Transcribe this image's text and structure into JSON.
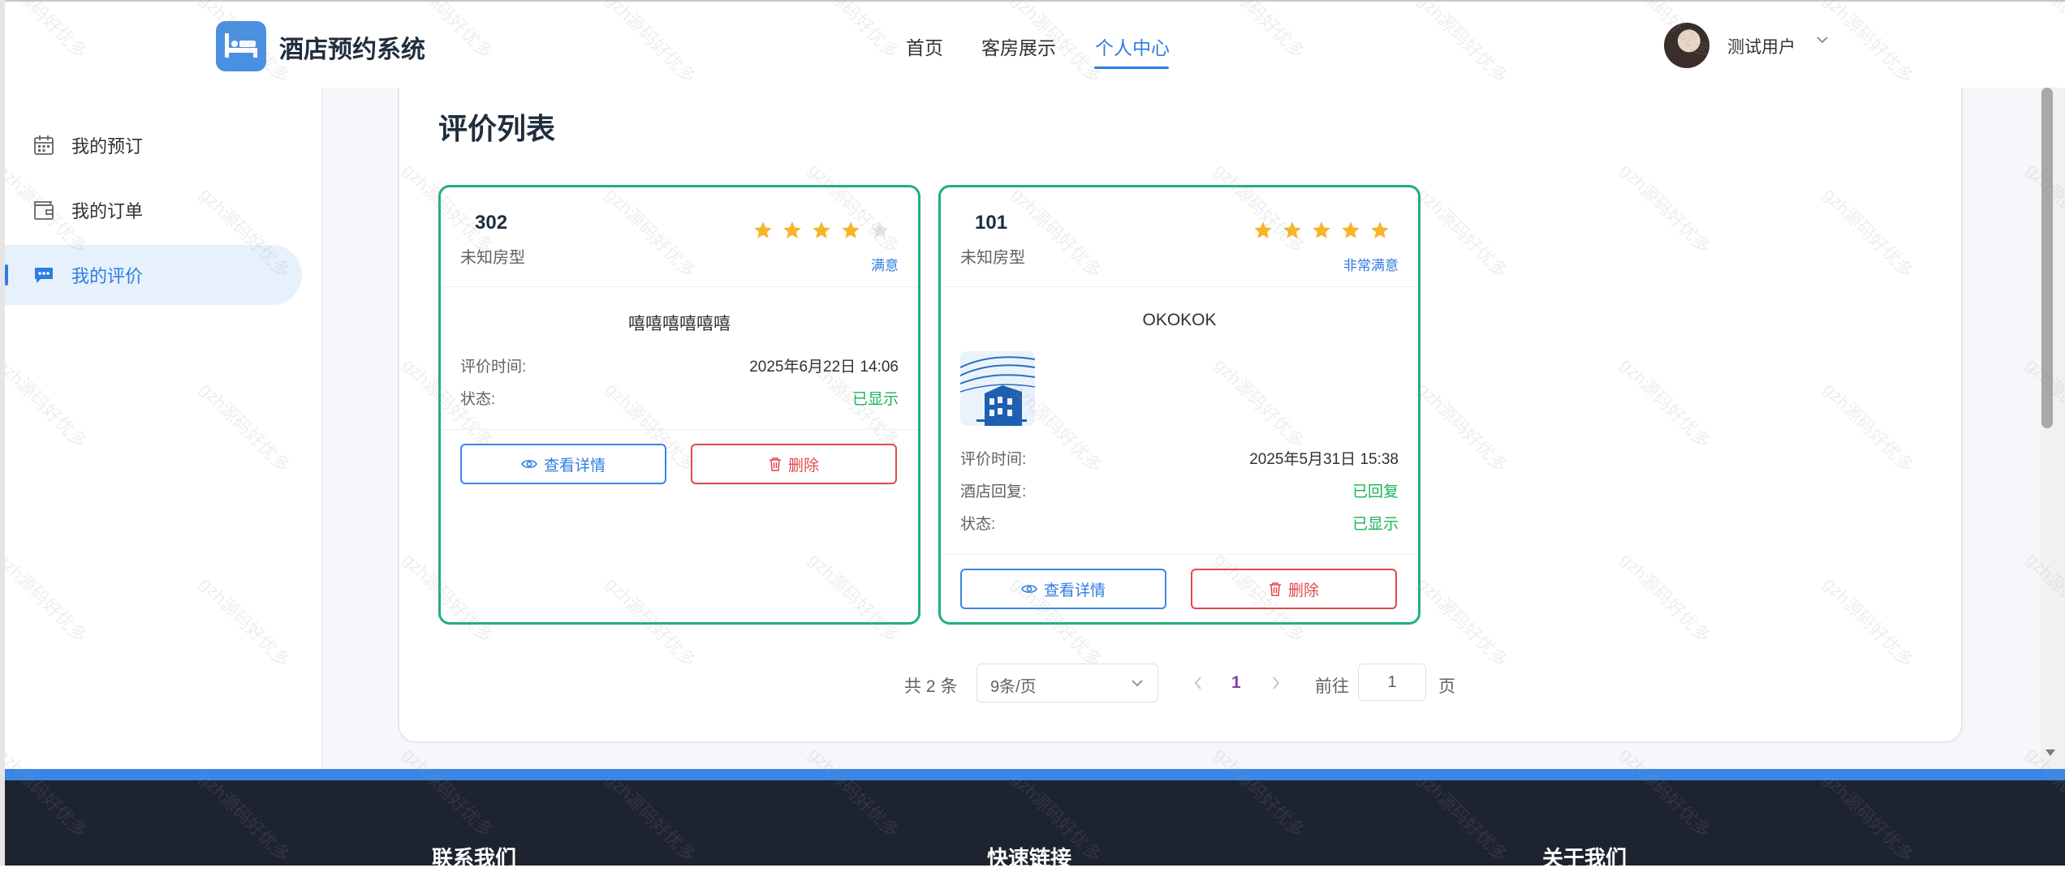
{
  "header": {
    "brand": "酒店预约系统",
    "nav": [
      {
        "label": "首页",
        "active": false
      },
      {
        "label": "客房展示",
        "active": false
      },
      {
        "label": "个人中心",
        "active": true
      }
    ],
    "user": {
      "name": "测试用户"
    }
  },
  "sidebar": {
    "items": [
      {
        "label": "我的预订",
        "icon": "calendar-icon",
        "active": false
      },
      {
        "label": "我的订单",
        "icon": "wallet-icon",
        "active": false
      },
      {
        "label": "我的评价",
        "icon": "chat-icon",
        "active": true
      }
    ]
  },
  "main": {
    "title": "评价列表",
    "cards": [
      {
        "room": "302",
        "room_type": "未知房型",
        "rating": 4,
        "max_rating": 5,
        "satisfaction": "满意",
        "comment": "嘻嘻嘻嘻嘻嘻",
        "rows": [
          {
            "label": "评价时间:",
            "value": "2025年6月22日 14:06",
            "color": "#303133"
          },
          {
            "label": "状态:",
            "value": "已显示",
            "color": "#19b35a"
          }
        ],
        "has_image": false,
        "detail_label": "查看详情",
        "delete_label": "删除"
      },
      {
        "room": "101",
        "room_type": "未知房型",
        "rating": 5,
        "max_rating": 5,
        "satisfaction": "非常满意",
        "comment": "OKOKOK",
        "rows": [
          {
            "label": "评价时间:",
            "value": "2025年5月31日 15:38",
            "color": "#303133"
          },
          {
            "label": "酒店回复:",
            "value": "已回复",
            "color": "#19b35a"
          },
          {
            "label": "状态:",
            "value": "已显示",
            "color": "#19b35a"
          }
        ],
        "has_image": true,
        "detail_label": "查看详情",
        "delete_label": "删除"
      }
    ]
  },
  "pagination": {
    "total_text": "共 2 条",
    "page_size": "9条/页",
    "current_page": "1",
    "goto_label": "前往",
    "goto_value": "1",
    "page_suffix": "页"
  },
  "footer": {
    "headings": [
      "联系我们",
      "快速链接",
      "关于我们"
    ]
  },
  "watermark": "gzh源码好优多",
  "colors": {
    "accent": "#2f7de1",
    "card_border": "#21b07d",
    "danger": "#e0494d",
    "success": "#19b35a",
    "star": "#f7b529",
    "footer": "#1e2330"
  }
}
